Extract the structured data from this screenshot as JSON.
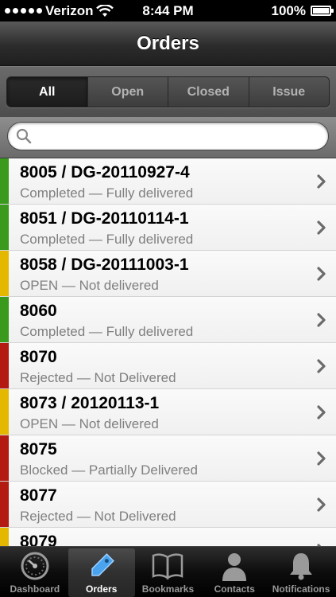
{
  "status_bar": {
    "carrier": "Verizon",
    "time": "8:44 PM",
    "battery": "100%",
    "battery_level": 1.0
  },
  "nav": {
    "title": "Orders"
  },
  "segments": [
    {
      "label": "All",
      "selected": true
    },
    {
      "label": "Open",
      "selected": false
    },
    {
      "label": "Closed",
      "selected": false
    },
    {
      "label": "Issue",
      "selected": false
    }
  ],
  "search": {
    "placeholder": "",
    "value": ""
  },
  "colors": {
    "completed": "#3a9a1e",
    "open": "#e5b800",
    "problem": "#b31a12"
  },
  "orders": [
    {
      "title": "8005 / DG-20110927-4",
      "subtitle": "Completed — Fully delivered",
      "status": "completed"
    },
    {
      "title": "8051 / DG-20110114-1",
      "subtitle": "Completed — Fully delivered",
      "status": "completed"
    },
    {
      "title": "8058 / DG-20111003-1",
      "subtitle": "OPEN — Not delivered",
      "status": "open"
    },
    {
      "title": "8060",
      "subtitle": "Completed — Fully delivered",
      "status": "completed"
    },
    {
      "title": "8070",
      "subtitle": "Rejected — Not Delivered",
      "status": "problem"
    },
    {
      "title": "8073 / 20120113-1",
      "subtitle": "OPEN — Not delivered",
      "status": "open"
    },
    {
      "title": "8075",
      "subtitle": "Blocked — Partially Delivered",
      "status": "problem"
    },
    {
      "title": "8077",
      "subtitle": "Rejected — Not Delivered",
      "status": "problem"
    },
    {
      "title": "8079",
      "subtitle": "",
      "status": "open"
    }
  ],
  "tabs": [
    {
      "label": "Dashboard",
      "icon": "speedometer-icon",
      "selected": false
    },
    {
      "label": "Orders",
      "icon": "tag-icon",
      "selected": true
    },
    {
      "label": "Bookmarks",
      "icon": "book-icon",
      "selected": false
    },
    {
      "label": "Contacts",
      "icon": "person-icon",
      "selected": false
    },
    {
      "label": "Notifications",
      "icon": "bell-icon",
      "selected": false
    }
  ]
}
